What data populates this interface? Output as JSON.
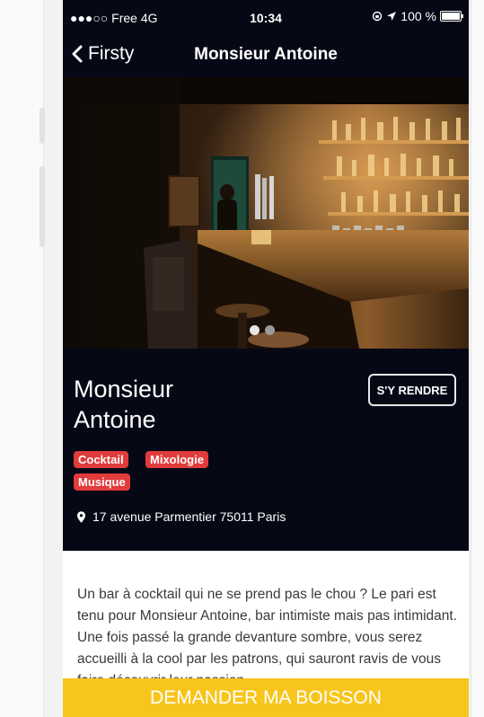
{
  "status_bar": {
    "carrier": "●●●○○ Free  4G",
    "time": "10:34",
    "battery": "100 %"
  },
  "nav": {
    "back_label": "Firsty",
    "title": "Monsieur Antoine"
  },
  "venue": {
    "name_line1": "Monsieur",
    "name_line2": "Antoine",
    "directions_label": "S'Y RENDRE",
    "tags": [
      "Cocktail",
      "Mixologie",
      "Musique"
    ],
    "address": "17 avenue Parmentier 75011 Paris",
    "description": "Un bar à cocktail qui ne se prend pas le chou ? Le pari est tenu pour Monsieur Antoine, bar intimiste mais pas intimidant. Une fois passé la grande devanture sombre, vous serez accueilli à la cool par les patrons, qui sauront ravis de vous faire découvrir leur passion"
  },
  "carousel": {
    "pages": 2,
    "active": 1
  },
  "cta": {
    "label": "DEMANDER MA BOISSON"
  },
  "colors": {
    "accent": "#f8c51c",
    "tag": "#e23b3b",
    "dark": "#060816"
  },
  "icons": {
    "back": "chevron-left-icon",
    "location": "location-pin-icon"
  }
}
